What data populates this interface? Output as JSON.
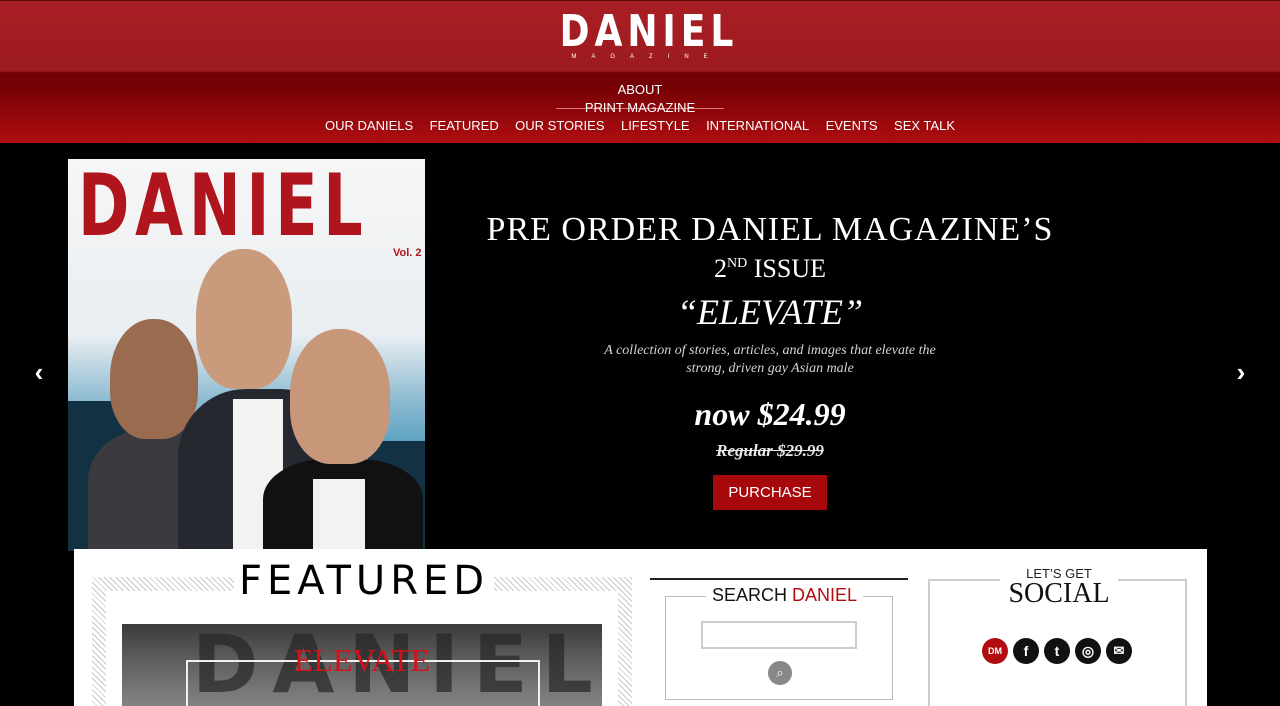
{
  "header": {
    "logo": "DANIEL",
    "logo_sub": "MAGAZINE",
    "util_nav": [
      "ABOUT",
      "PRINT MAGAZINE"
    ],
    "main_nav": [
      "OUR DANIELS",
      "FEATURED",
      "OUR STORIES",
      "LIFESTYLE",
      "INTERNATIONAL",
      "EVENTS",
      "SEX TALK"
    ]
  },
  "hero": {
    "cover_title": "DANIEL",
    "cover_vol": "Vol. 2",
    "line1": "PRE ORDER DANIEL MAGAZINE’S",
    "line2_num": "2",
    "line2_sup": "ND",
    "line2_rest": "ISSUE",
    "issue_title": "“ELEVATE”",
    "description": "A collection of stories, articles, and images that elevate the strong, driven gay Asian male",
    "price": "now $24.99",
    "regular": "Regular $29.99",
    "purchase_label": "PURCHASE",
    "arrow_left": "‹",
    "arrow_right": "›"
  },
  "featured": {
    "title": "FEATURED",
    "image_bg_text": "DANIEL",
    "image_title": "ELEVATE"
  },
  "search": {
    "title_black": "SEARCH",
    "title_red": "DANIEL",
    "input_value": "",
    "button_icon": "search-icon"
  },
  "social": {
    "head_small": "LET’S GET",
    "head_big": "SOCIAL",
    "icons": [
      {
        "name": "dm-icon",
        "glyph": "DM"
      },
      {
        "name": "facebook-icon",
        "glyph": "f"
      },
      {
        "name": "twitter-icon",
        "glyph": "t"
      },
      {
        "name": "instagram-icon",
        "glyph": "◎"
      },
      {
        "name": "email-icon",
        "glyph": "✉"
      }
    ]
  },
  "colors": {
    "brand_red": "#a7080c",
    "header_red": "#a81f24"
  }
}
